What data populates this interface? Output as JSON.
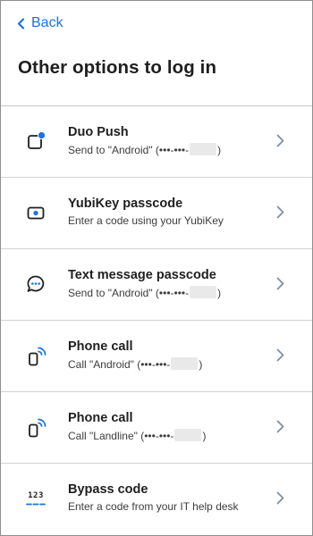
{
  "nav": {
    "back_label": "Back"
  },
  "page": {
    "title": "Other options to log in"
  },
  "options": [
    {
      "title": "Duo Push",
      "desc_pre": "Send to \"Android\" (•••-•••-",
      "desc_post": ")",
      "icon": "duo-push-icon"
    },
    {
      "title": "YubiKey passcode",
      "desc": "Enter a code using your YubiKey",
      "icon": "yubikey-icon"
    },
    {
      "title": "Text message passcode",
      "desc_pre": "Send to \"Android\" (•••-•••-",
      "desc_post": ")",
      "icon": "text-message-icon"
    },
    {
      "title": "Phone call",
      "desc_pre": "Call \"Android\" (•••-•••-",
      "desc_post": ")",
      "icon": "phone-call-icon"
    },
    {
      "title": "Phone call",
      "desc_pre": "Call \"Landline\" (•••-•••-",
      "desc_post": ")",
      "icon": "phone-call-icon"
    },
    {
      "title": "Bypass code",
      "desc": "Enter a code from your IT help desk",
      "icon": "bypass-code-icon",
      "icon_text": "123"
    }
  ],
  "colors": {
    "accent": "#1a73e8",
    "chevron": "#7d8da3",
    "divider": "#d2d2d2"
  }
}
